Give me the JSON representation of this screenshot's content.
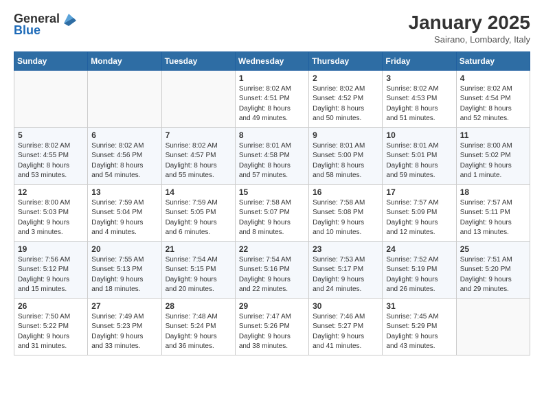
{
  "header": {
    "logo_line1": "General",
    "logo_line2": "Blue",
    "title": "January 2025",
    "location": "Sairano, Lombardy, Italy"
  },
  "weekdays": [
    "Sunday",
    "Monday",
    "Tuesday",
    "Wednesday",
    "Thursday",
    "Friday",
    "Saturday"
  ],
  "weeks": [
    [
      {
        "day": "",
        "info": ""
      },
      {
        "day": "",
        "info": ""
      },
      {
        "day": "",
        "info": ""
      },
      {
        "day": "1",
        "info": "Sunrise: 8:02 AM\nSunset: 4:51 PM\nDaylight: 8 hours\nand 49 minutes."
      },
      {
        "day": "2",
        "info": "Sunrise: 8:02 AM\nSunset: 4:52 PM\nDaylight: 8 hours\nand 50 minutes."
      },
      {
        "day": "3",
        "info": "Sunrise: 8:02 AM\nSunset: 4:53 PM\nDaylight: 8 hours\nand 51 minutes."
      },
      {
        "day": "4",
        "info": "Sunrise: 8:02 AM\nSunset: 4:54 PM\nDaylight: 8 hours\nand 52 minutes."
      }
    ],
    [
      {
        "day": "5",
        "info": "Sunrise: 8:02 AM\nSunset: 4:55 PM\nDaylight: 8 hours\nand 53 minutes."
      },
      {
        "day": "6",
        "info": "Sunrise: 8:02 AM\nSunset: 4:56 PM\nDaylight: 8 hours\nand 54 minutes."
      },
      {
        "day": "7",
        "info": "Sunrise: 8:02 AM\nSunset: 4:57 PM\nDaylight: 8 hours\nand 55 minutes."
      },
      {
        "day": "8",
        "info": "Sunrise: 8:01 AM\nSunset: 4:58 PM\nDaylight: 8 hours\nand 57 minutes."
      },
      {
        "day": "9",
        "info": "Sunrise: 8:01 AM\nSunset: 5:00 PM\nDaylight: 8 hours\nand 58 minutes."
      },
      {
        "day": "10",
        "info": "Sunrise: 8:01 AM\nSunset: 5:01 PM\nDaylight: 8 hours\nand 59 minutes."
      },
      {
        "day": "11",
        "info": "Sunrise: 8:00 AM\nSunset: 5:02 PM\nDaylight: 9 hours\nand 1 minute."
      }
    ],
    [
      {
        "day": "12",
        "info": "Sunrise: 8:00 AM\nSunset: 5:03 PM\nDaylight: 9 hours\nand 3 minutes."
      },
      {
        "day": "13",
        "info": "Sunrise: 7:59 AM\nSunset: 5:04 PM\nDaylight: 9 hours\nand 4 minutes."
      },
      {
        "day": "14",
        "info": "Sunrise: 7:59 AM\nSunset: 5:05 PM\nDaylight: 9 hours\nand 6 minutes."
      },
      {
        "day": "15",
        "info": "Sunrise: 7:58 AM\nSunset: 5:07 PM\nDaylight: 9 hours\nand 8 minutes."
      },
      {
        "day": "16",
        "info": "Sunrise: 7:58 AM\nSunset: 5:08 PM\nDaylight: 9 hours\nand 10 minutes."
      },
      {
        "day": "17",
        "info": "Sunrise: 7:57 AM\nSunset: 5:09 PM\nDaylight: 9 hours\nand 12 minutes."
      },
      {
        "day": "18",
        "info": "Sunrise: 7:57 AM\nSunset: 5:11 PM\nDaylight: 9 hours\nand 13 minutes."
      }
    ],
    [
      {
        "day": "19",
        "info": "Sunrise: 7:56 AM\nSunset: 5:12 PM\nDaylight: 9 hours\nand 15 minutes."
      },
      {
        "day": "20",
        "info": "Sunrise: 7:55 AM\nSunset: 5:13 PM\nDaylight: 9 hours\nand 18 minutes."
      },
      {
        "day": "21",
        "info": "Sunrise: 7:54 AM\nSunset: 5:15 PM\nDaylight: 9 hours\nand 20 minutes."
      },
      {
        "day": "22",
        "info": "Sunrise: 7:54 AM\nSunset: 5:16 PM\nDaylight: 9 hours\nand 22 minutes."
      },
      {
        "day": "23",
        "info": "Sunrise: 7:53 AM\nSunset: 5:17 PM\nDaylight: 9 hours\nand 24 minutes."
      },
      {
        "day": "24",
        "info": "Sunrise: 7:52 AM\nSunset: 5:19 PM\nDaylight: 9 hours\nand 26 minutes."
      },
      {
        "day": "25",
        "info": "Sunrise: 7:51 AM\nSunset: 5:20 PM\nDaylight: 9 hours\nand 29 minutes."
      }
    ],
    [
      {
        "day": "26",
        "info": "Sunrise: 7:50 AM\nSunset: 5:22 PM\nDaylight: 9 hours\nand 31 minutes."
      },
      {
        "day": "27",
        "info": "Sunrise: 7:49 AM\nSunset: 5:23 PM\nDaylight: 9 hours\nand 33 minutes."
      },
      {
        "day": "28",
        "info": "Sunrise: 7:48 AM\nSunset: 5:24 PM\nDaylight: 9 hours\nand 36 minutes."
      },
      {
        "day": "29",
        "info": "Sunrise: 7:47 AM\nSunset: 5:26 PM\nDaylight: 9 hours\nand 38 minutes."
      },
      {
        "day": "30",
        "info": "Sunrise: 7:46 AM\nSunset: 5:27 PM\nDaylight: 9 hours\nand 41 minutes."
      },
      {
        "day": "31",
        "info": "Sunrise: 7:45 AM\nSunset: 5:29 PM\nDaylight: 9 hours\nand 43 minutes."
      },
      {
        "day": "",
        "info": ""
      }
    ]
  ]
}
